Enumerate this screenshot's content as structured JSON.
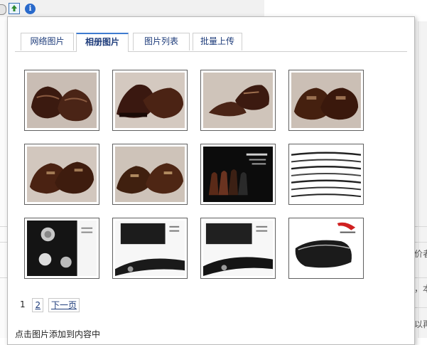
{
  "toolbar": {
    "image_button_icon": "image-upload-icon",
    "info_button_icon": "info-icon",
    "info_glyph": "i"
  },
  "background": {
    "right_text": [
      "价者",
      "，本",
      "以再"
    ]
  },
  "dialog": {
    "tabs": [
      {
        "label": "网络图片",
        "active": false
      },
      {
        "label": "相册图片",
        "active": true
      },
      {
        "label": "图片列表",
        "active": false
      },
      {
        "label": "批量上传",
        "active": false
      }
    ],
    "thumbnails": [
      {
        "name": "brown-monk-shoes-pair"
      },
      {
        "name": "brown-loafer-side"
      },
      {
        "name": "brown-monk-shoe-angle"
      },
      {
        "name": "brown-monk-shoes-front"
      },
      {
        "name": "brown-double-monk-pair"
      },
      {
        "name": "brown-double-monk-side"
      },
      {
        "name": "shoe-lineup-dark-ad"
      },
      {
        "name": "wavy-lines-graphic"
      },
      {
        "name": "metal-buttons-closeup"
      },
      {
        "name": "vrc-logo-zipper-detail"
      },
      {
        "name": "vrc-logo-zipper-dark"
      },
      {
        "name": "black-clutch-bag"
      }
    ],
    "pagination": {
      "current": "1",
      "pages": [
        "2"
      ],
      "next_label": "下一页"
    },
    "hint": "点击图片添加到内容中"
  },
  "colors": {
    "tab_text": "#1d3b7a",
    "active_tab_border": "#3e7bd0",
    "thumb_border": "#606060"
  }
}
